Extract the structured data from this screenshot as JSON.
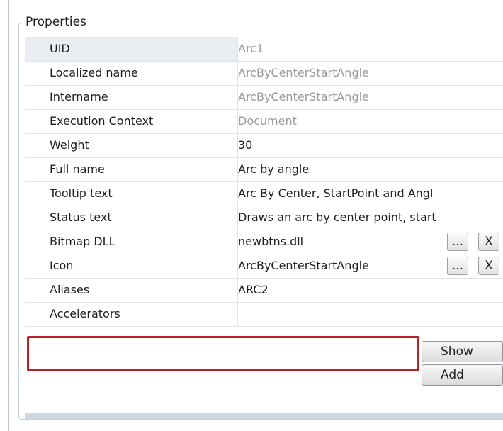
{
  "group": {
    "title": "Properties"
  },
  "rows": [
    {
      "name": "UID",
      "value": "Arc1"
    },
    {
      "name": "Localized name",
      "value": "ArcByCenterStartAngle"
    },
    {
      "name": "Intername",
      "value": "ArcByCenterStartAngle"
    },
    {
      "name": "Execution Context",
      "value": "Document"
    },
    {
      "name": "Weight",
      "value": "30"
    },
    {
      "name": "Full name",
      "value": "Arc by angle"
    },
    {
      "name": "Tooltip text",
      "value": "Arc By Center, StartPoint and Angl"
    },
    {
      "name": "Status text",
      "value": "Draws an arc by center point, start"
    },
    {
      "name": "Bitmap DLL",
      "value": "newbtns.dll",
      "browse_label": "...",
      "clear_label": "X"
    },
    {
      "name": "Icon",
      "value": "ArcByCenterStartAngle",
      "browse_label": "...",
      "clear_label": "X"
    },
    {
      "name": "Aliases",
      "value": "ARC2",
      "button_label": "Show"
    },
    {
      "name": "Accelerators",
      "value": "",
      "button_label": "Add"
    }
  ],
  "colors": {
    "highlight_border": "#b8232b",
    "readonly_text": "#9a9a9a",
    "selected_row": "#e9ecf1"
  }
}
